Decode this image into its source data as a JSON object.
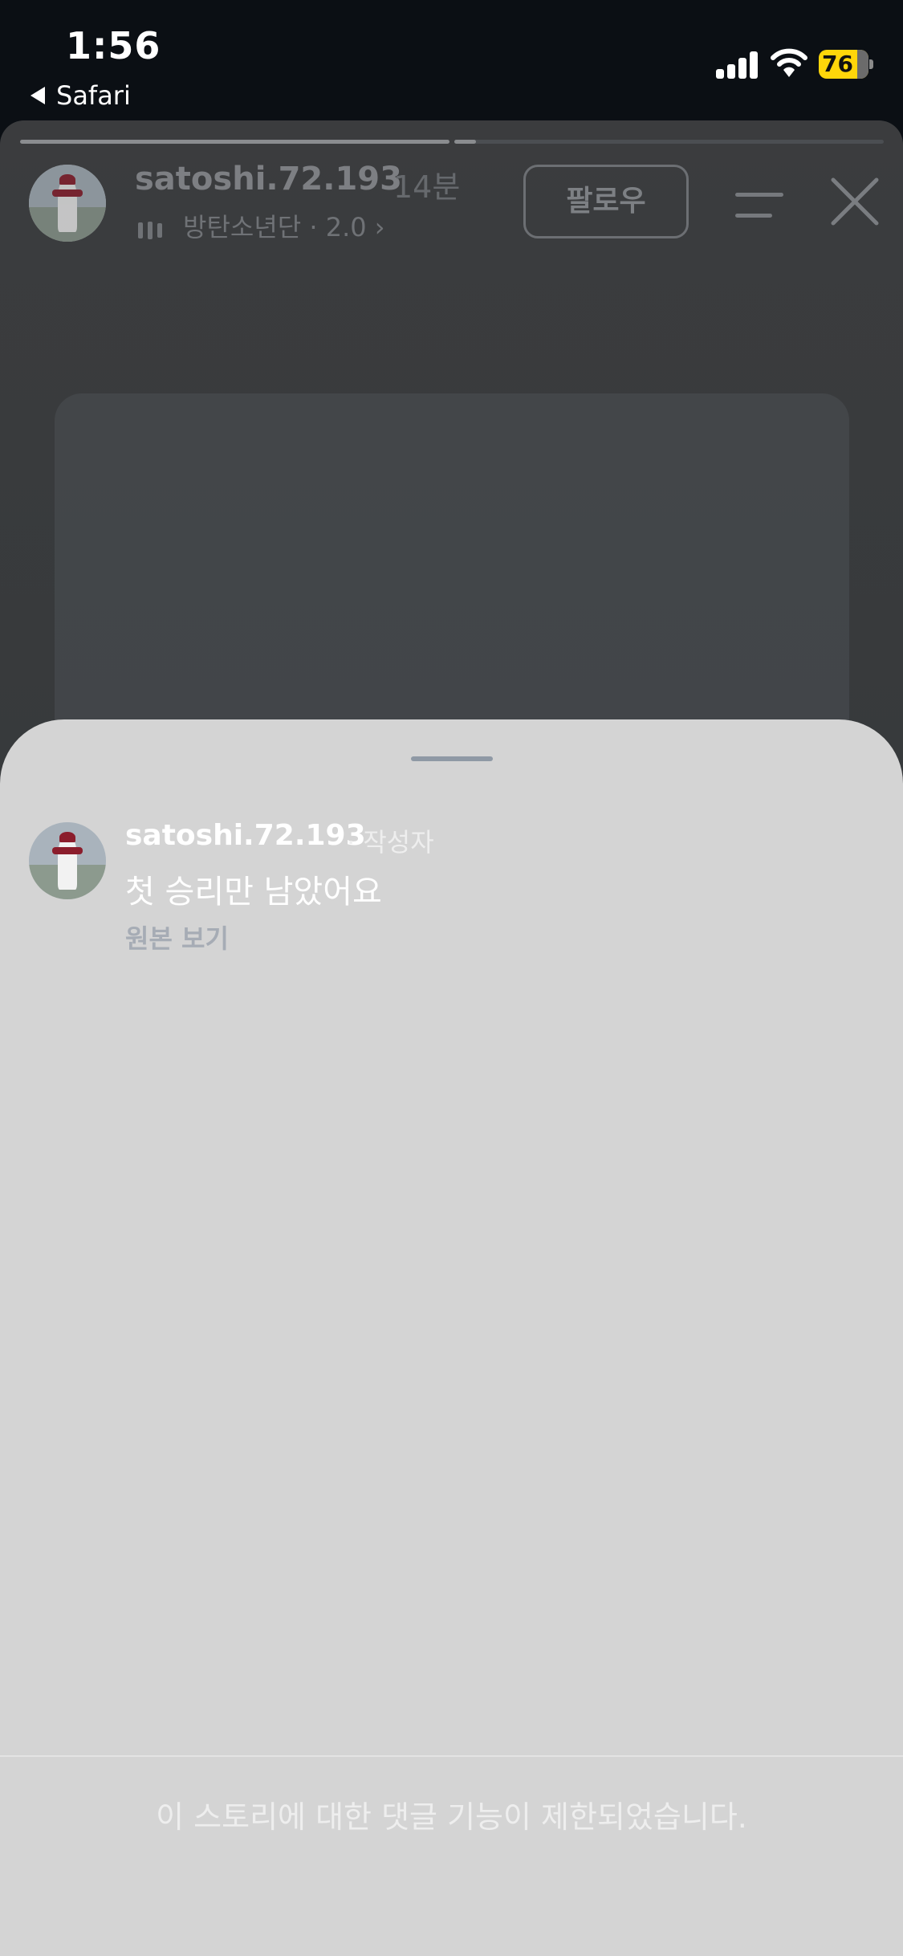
{
  "status_bar": {
    "time": "1:56",
    "back_label": "Safari",
    "battery_level": "76",
    "battery_color": "#ffd60a"
  },
  "story": {
    "username": "satoshi.72.193",
    "time_ago": "14분",
    "music": "방탄소년단 · 2.0 ›",
    "follow_label": "팔로우",
    "progress_segments": [
      1,
      0.05
    ]
  },
  "sheet": {
    "comment": {
      "username": "satoshi.72.193",
      "author_tag": "· 작성자",
      "text": "첫 승리만 남았어요",
      "view_original": "원본 보기"
    },
    "restricted_notice": "이 스토리에 대한 댓글 기능이 제한되었습니다."
  },
  "icons": [
    "back-arrow-icon",
    "signal-icon",
    "wifi-icon",
    "battery-icon",
    "music-bars-icon",
    "menu-icon",
    "close-icon",
    "avatar"
  ]
}
